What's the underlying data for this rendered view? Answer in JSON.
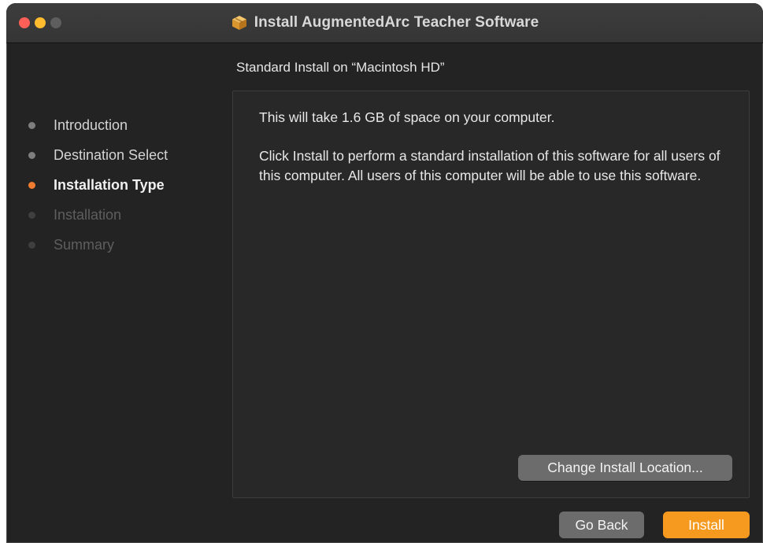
{
  "window": {
    "title": "Install AugmentedArc Teacher Software",
    "icon": "package-icon"
  },
  "heading": "Standard Install on “Macintosh HD”",
  "steps": [
    {
      "label": "Introduction",
      "state": "done"
    },
    {
      "label": "Destination Select",
      "state": "done"
    },
    {
      "label": "Installation Type",
      "state": "current"
    },
    {
      "label": "Installation",
      "state": "pending"
    },
    {
      "label": "Summary",
      "state": "pending"
    }
  ],
  "panel": {
    "space_text": "This will take 1.6 GB of space on your computer.",
    "description": "Click Install to perform a standard installation of this software for all users of this computer. All users of this computer will be able to use this software.",
    "change_location_label": "Change Install Location..."
  },
  "footer": {
    "go_back_label": "Go Back",
    "install_label": "Install"
  },
  "colors": {
    "accent": "#f59a1e",
    "current_step_dot": "#f07d2f",
    "window_bg": "#232323",
    "close": "#fe5f57",
    "minimize": "#febc2e"
  }
}
